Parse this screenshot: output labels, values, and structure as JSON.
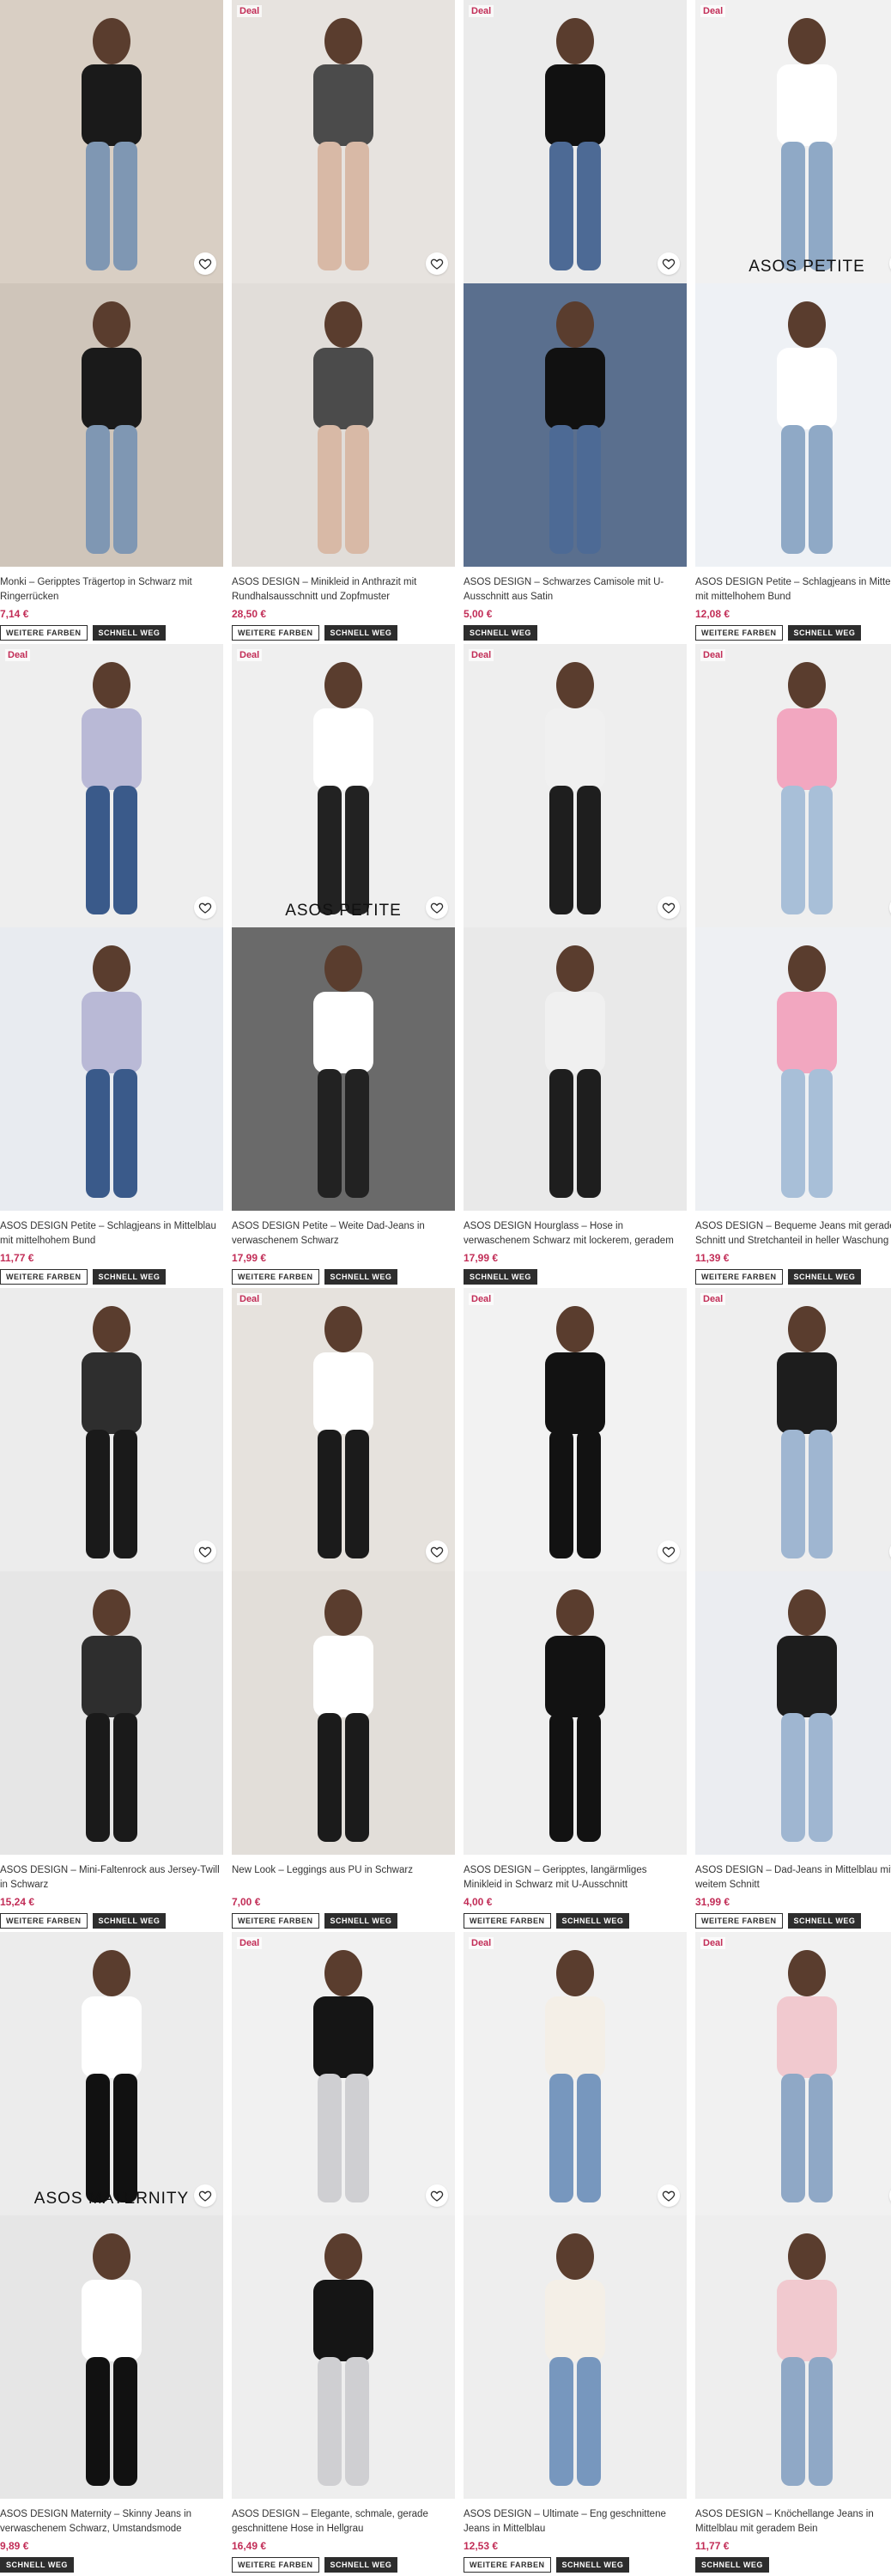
{
  "products": [
    {
      "deal": "",
      "title": "Monki – Geripptes Trägertop in Schwarz mit Ringerrücken",
      "price": "7,14 €",
      "badges": [
        "WEITERE FARBEN",
        "SCHNELL WEG"
      ],
      "brand_overlay": "",
      "palette": {
        "top": "#d9cfc4",
        "bot": "#cfc5ba"
      }
    },
    {
      "deal": "Deal",
      "title": "ASOS DESIGN – Minikleid in Anthrazit mit Rundhalsausschnitt und Zopfmuster",
      "price": "28,50 €",
      "badges": [
        "WEITERE FARBEN",
        "SCHNELL WEG"
      ],
      "brand_overlay": "",
      "palette": {
        "top": "#e7e3df",
        "bot": "#e1ddd9"
      }
    },
    {
      "deal": "Deal",
      "title": "ASOS DESIGN – Schwarzes Camisole mit U-Ausschnitt aus Satin",
      "price": "5,00 €",
      "badges": [
        "SCHNELL WEG"
      ],
      "brand_overlay": "",
      "palette": {
        "top": "#ebebeb",
        "bot": "#5a6f8e"
      }
    },
    {
      "deal": "Deal",
      "title": "ASOS DESIGN Petite – Schlagjeans in Mittelblau mit mittelhohem Bund",
      "price": "12,08 €",
      "badges": [
        "WEITERE FARBEN",
        "SCHNELL WEG"
      ],
      "brand_overlay": "ASOS PETITE",
      "palette": {
        "top": "#f1f1f1",
        "bot": "#eef1f5"
      }
    },
    {
      "deal": "Deal",
      "title": "ASOS DESIGN Petite – Schlagjeans in Mittelblau mit mittelhohem Bund",
      "price": "11,77 €",
      "badges": [
        "WEITERE FARBEN",
        "SCHNELL WEG"
      ],
      "brand_overlay": "",
      "palette": {
        "top": "#eeeeee",
        "bot": "#e8ebf0"
      }
    },
    {
      "deal": "Deal",
      "title": "ASOS DESIGN Petite – Weite Dad-Jeans in verwaschenem Schwarz",
      "price": "17,99 €",
      "badges": [
        "WEITERE FARBEN",
        "SCHNELL WEG"
      ],
      "brand_overlay": "ASOS PETITE",
      "palette": {
        "top": "#efefef",
        "bot": "#6a6a6a"
      }
    },
    {
      "deal": "Deal",
      "title": "ASOS DESIGN Hourglass – Hose in verwaschenem Schwarz mit lockerem, geradem Schnitt",
      "price": "17,99 €",
      "badges": [
        "SCHNELL WEG"
      ],
      "brand_overlay": "",
      "palette": {
        "top": "#eeeeee",
        "bot": "#e9e9e9"
      }
    },
    {
      "deal": "Deal",
      "title": "ASOS DESIGN – Bequeme Jeans mit geradem Schnitt und Stretchanteil in heller Waschung",
      "price": "11,39 €",
      "badges": [
        "WEITERE FARBEN",
        "SCHNELL WEG"
      ],
      "brand_overlay": "",
      "palette": {
        "top": "#efefef",
        "bot": "#eef0f3"
      }
    },
    {
      "deal": "",
      "title": "ASOS DESIGN – Mini-Faltenrock aus Jersey-Twill in Schwarz",
      "price": "15,24 €",
      "badges": [
        "WEITERE FARBEN",
        "SCHNELL WEG"
      ],
      "brand_overlay": "",
      "palette": {
        "top": "#ececec",
        "bot": "#e6e6e6"
      }
    },
    {
      "deal": "Deal",
      "title": "New Look – Leggings aus PU in Schwarz",
      "price": "7,00 €",
      "badges": [
        "WEITERE FARBEN",
        "SCHNELL WEG"
      ],
      "brand_overlay": "",
      "palette": {
        "top": "#e6e2dd",
        "bot": "#e2ded9"
      }
    },
    {
      "deal": "Deal",
      "title": "ASOS DESIGN – Geripptes, langärmliges Minikleid in Schwarz mit U-Ausschnitt",
      "price": "4,00 €",
      "badges": [
        "WEITERE FARBEN",
        "SCHNELL WEG"
      ],
      "brand_overlay": "",
      "palette": {
        "top": "#f2f2f2",
        "bot": "#efefef"
      }
    },
    {
      "deal": "Deal",
      "title": "ASOS DESIGN – Dad-Jeans in Mittelblau mit weitem Schnitt",
      "price": "31,99 €",
      "badges": [
        "WEITERE FARBEN",
        "SCHNELL WEG"
      ],
      "brand_overlay": "",
      "palette": {
        "top": "#eeeeee",
        "bot": "#ebedf1"
      }
    },
    {
      "deal": "",
      "title": "ASOS DESIGN Maternity – Skinny Jeans in verwaschenem Schwarz, Umstandsmode",
      "price": "9,89 €",
      "badges": [
        "SCHNELL WEG"
      ],
      "brand_overlay": "ASOS MATERNITY",
      "palette": {
        "top": "#ececec",
        "bot": "#e6e6e6"
      }
    },
    {
      "deal": "Deal",
      "title": "ASOS DESIGN – Elegante, schmale, gerade geschnittene Hose in Hellgrau",
      "price": "16,49 €",
      "badges": [
        "WEITERE FARBEN",
        "SCHNELL WEG"
      ],
      "brand_overlay": "",
      "palette": {
        "top": "#f1f1f1",
        "bot": "#eeeeee"
      }
    },
    {
      "deal": "Deal",
      "title": "ASOS DESIGN – Ultimate – Eng geschnittene Jeans in Mittelblau",
      "price": "12,53 €",
      "badges": [
        "WEITERE FARBEN",
        "SCHNELL WEG"
      ],
      "brand_overlay": "",
      "palette": {
        "top": "#f1f1f1",
        "bot": "#eeeeee"
      }
    },
    {
      "deal": "Deal",
      "title": "ASOS DESIGN – Knöchellange Jeans in Mittelblau mit geradem Bein",
      "price": "11,77 €",
      "badges": [
        "SCHNELL WEG"
      ],
      "brand_overlay": "",
      "palette": {
        "top": "#f1f1f1",
        "bot": "#eeeeee"
      }
    }
  ],
  "icons": {
    "wishlist": "heart-icon"
  }
}
